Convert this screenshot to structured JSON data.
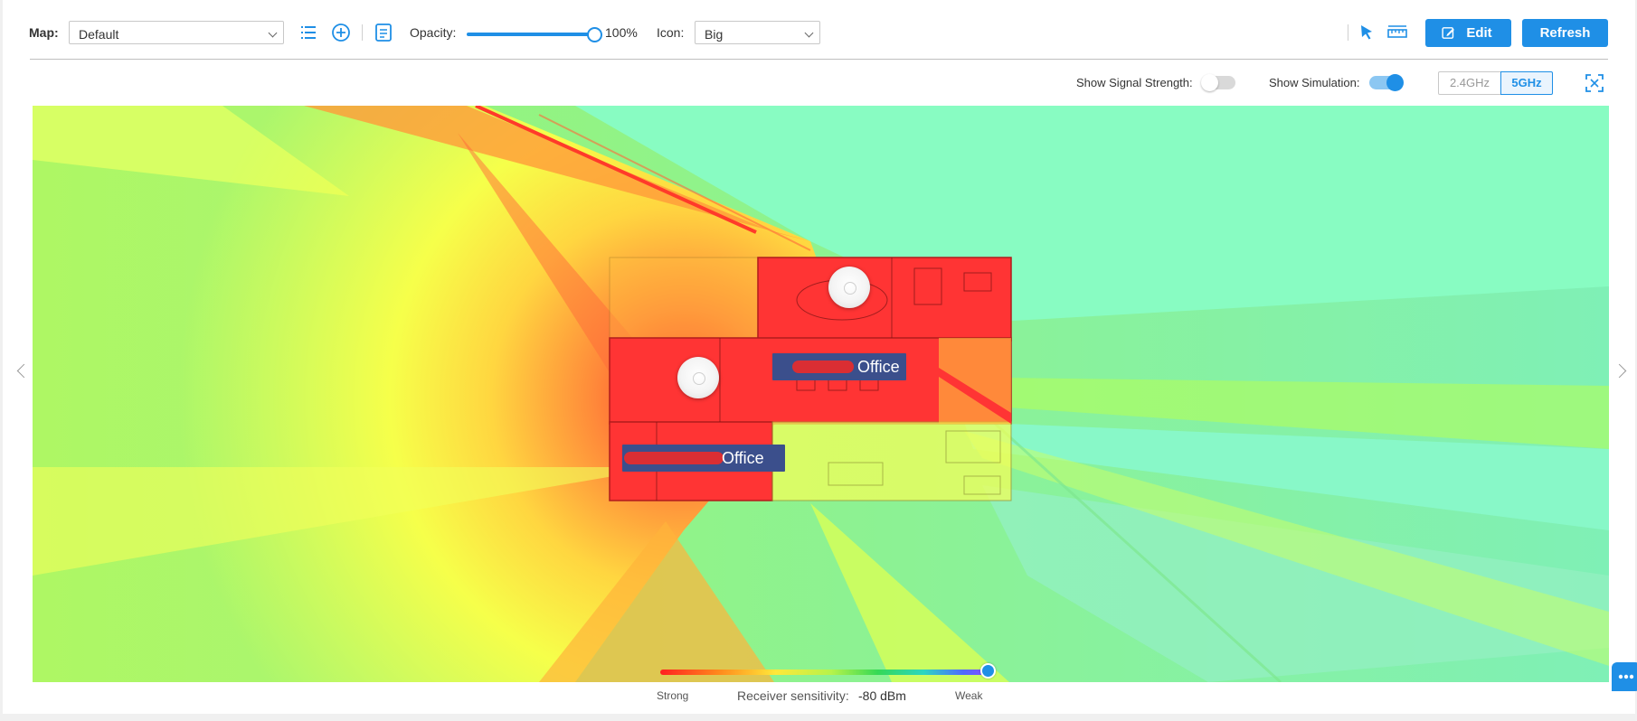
{
  "toolbar": {
    "map_label": "Map:",
    "map_value": "Default",
    "opacity_label": "Opacity:",
    "opacity_value": "100%",
    "opacity_level": 1.0,
    "icon_label": "Icon:",
    "icon_value": "Big",
    "edit_label": "Edit",
    "refresh_label": "Refresh",
    "icons": [
      "list-icon",
      "add-circle-icon",
      "notes-icon",
      "select-pointer-icon",
      "ruler-icon",
      "edit-icon"
    ]
  },
  "options": {
    "signal_strength_label": "Show Signal Strength:",
    "signal_strength_on": false,
    "simulation_label": "Show Simulation:",
    "simulation_on": true,
    "band_24": "2.4GHz",
    "band_5": "5GHz",
    "active_band": "5GHz"
  },
  "floorplan": {
    "rooms": [
      {
        "label": "Office"
      },
      {
        "label": "Office"
      }
    ]
  },
  "legend": {
    "strong_label": "Strong",
    "weak_label": "Weak",
    "sensitivity_label": "Receiver sensitivity:",
    "sensitivity_value": "-80 dBm",
    "sensitivity_level": 1.0
  },
  "colors": {
    "accent": "#1f8fe6",
    "room_label_bg": "#3b4f8c",
    "heat_strong": "#ff3030",
    "heat_mid": "#ffe83a",
    "heat_weak": "#7cf58a"
  }
}
